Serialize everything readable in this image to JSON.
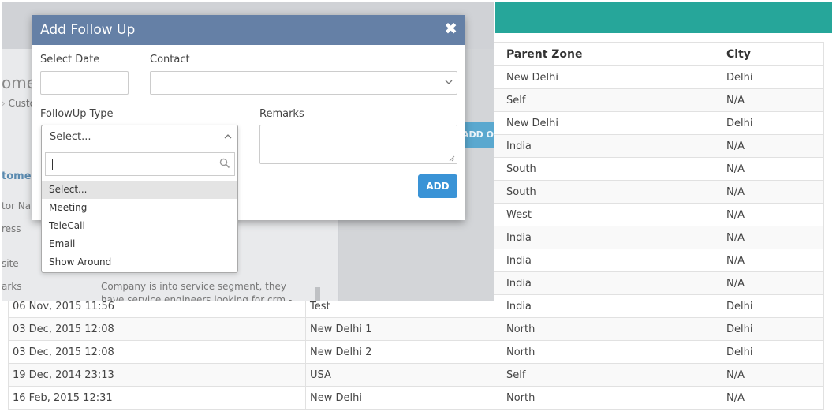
{
  "table": {
    "headers": [
      "Parent Zone",
      "City"
    ],
    "rows": [
      [
        "",
        "",
        "New Delhi",
        "Delhi"
      ],
      [
        "",
        "",
        "Self",
        "N/A"
      ],
      [
        "",
        "",
        "New Delhi",
        "Delhi"
      ],
      [
        "",
        "",
        "India",
        "N/A"
      ],
      [
        "",
        "",
        "South",
        "N/A"
      ],
      [
        "",
        "",
        "South",
        "N/A"
      ],
      [
        "",
        "",
        "West",
        "N/A"
      ],
      [
        "",
        "",
        "India",
        "N/A"
      ],
      [
        "",
        "",
        "India",
        "N/A"
      ],
      [
        "",
        "",
        "India",
        "N/A"
      ],
      [
        "06 Nov, 2015 11:56",
        "Test",
        "India",
        "Delhi"
      ],
      [
        "03 Dec, 2015 12:08",
        "New Delhi 1",
        "North",
        "Delhi"
      ],
      [
        "03 Dec, 2015 12:08",
        "New Delhi 2",
        "North",
        "Delhi"
      ],
      [
        "19 Dec, 2014 23:13",
        "USA",
        "Self",
        "N/A"
      ],
      [
        "16 Feb, 2015 12:31",
        "New Delhi",
        "North",
        "N/A"
      ]
    ]
  },
  "background": {
    "heading_fragment": "ome",
    "breadcrumb_fragment": "Custo",
    "add_button_fragment": "ADD OR",
    "section_link_fragment": "tomer",
    "field_labels": [
      "tor Nar",
      "ress",
      "site",
      "arks"
    ],
    "remarks_text_line1": "Company is into service segment, they",
    "remarks_text_line2": "have service engineers looking for crm -"
  },
  "modal": {
    "title": "Add Follow Up",
    "close_symbol": "✖",
    "select_date_label": "Select Date",
    "select_date_value": "",
    "contact_label": "Contact",
    "contact_value": "",
    "followup_type_label": "FollowUp Type",
    "remarks_label": "Remarks",
    "remarks_value": "",
    "add_label": "ADD"
  },
  "dropdown": {
    "selected": "Select...",
    "search_value": "",
    "options": [
      "Select...",
      "Meeting",
      "TeleCall",
      "Email",
      "Show Around"
    ],
    "active_index": 0
  },
  "colors": {
    "header_teal": "#26a69a",
    "modal_header": "#6580a6",
    "add_button": "#3a93d6"
  }
}
